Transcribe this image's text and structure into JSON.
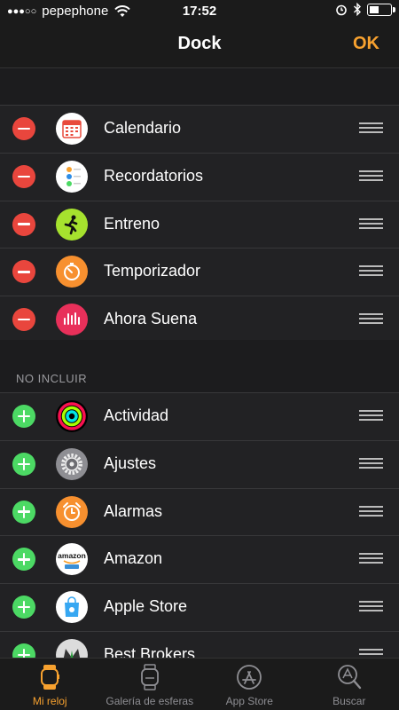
{
  "status": {
    "carrier": "pepephone",
    "time": "17:52"
  },
  "nav": {
    "title": "Dock",
    "ok_label": "OK"
  },
  "dock_items": [
    {
      "label": "Calendario",
      "icon": "calendar-icon"
    },
    {
      "label": "Recordatorios",
      "icon": "reminders-icon"
    },
    {
      "label": "Entreno",
      "icon": "workout-icon"
    },
    {
      "label": "Temporizador",
      "icon": "timer-icon"
    },
    {
      "label": "Ahora Suena",
      "icon": "now-playing-icon"
    }
  ],
  "excluded": {
    "header": "NO INCLUIR",
    "items": [
      {
        "label": "Actividad",
        "icon": "activity-icon"
      },
      {
        "label": "Ajustes",
        "icon": "settings-icon"
      },
      {
        "label": "Alarmas",
        "icon": "alarms-icon"
      },
      {
        "label": "Amazon",
        "icon": "amazon-icon"
      },
      {
        "label": "Apple Store",
        "icon": "apple-store-icon"
      },
      {
        "label": "Best Brokers",
        "icon": "best-brokers-icon"
      }
    ]
  },
  "tabs": [
    {
      "label": "Mi reloj",
      "active": true
    },
    {
      "label": "Galería de esferas",
      "active": false
    },
    {
      "label": "App Store",
      "active": false
    },
    {
      "label": "Buscar",
      "active": false
    }
  ],
  "colors": {
    "accent": "#f7a12f",
    "remove": "#e9463d",
    "add": "#4cd964"
  },
  "amazon_logo_text": "amazon"
}
